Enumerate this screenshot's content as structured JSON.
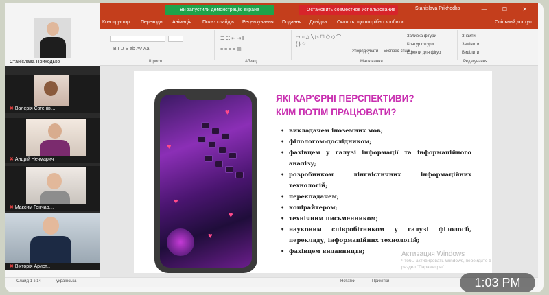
{
  "sharebar": {
    "green_notice": "Ви запустили демонстрацію екрана",
    "red_button": "Остановить совместное использование",
    "presenter": "Stanislava Prikhodko",
    "window_controls": "— ☐ ✕"
  },
  "ribbon": {
    "tabs": [
      "Конструктор",
      "Переходи",
      "Анімація",
      "Показ слайдів",
      "Рецензування",
      "Подання",
      "Довідка",
      "Скажіть, що потрібно зробити"
    ],
    "share_label": "Спільний доступ",
    "groups": [
      "Шрифт",
      "Абзац",
      "Малювання",
      "Редагування"
    ],
    "find": "Знайти",
    "replace": "Замінити",
    "select": "Виділити",
    "arrange": "Упорядкувати",
    "styles": "Експрес-стилі",
    "fill": "Заливка фігури",
    "outline": "Контур фігури",
    "effects": "Ефекти для фігур"
  },
  "participants": [
    {
      "name": "Станіслава Приходько"
    },
    {
      "name": "Валерія Євгенів…"
    },
    {
      "name": "Андрій Нечмарич"
    },
    {
      "name": "Максим Гончар…"
    },
    {
      "name": "Вікторія Арист…"
    }
  ],
  "slide": {
    "title_line1": "ЯКІ КАР'ЄРНІ ПЕРСПЕКТИВИ?",
    "title_line2": "КИМ ПОТІМ ПРАЦЮВАТИ?",
    "bullets": [
      "викладачем іноземних мов;",
      "філологом-дослідником;",
      "фахівцем у галузі інформації та інформаційного аналізу;",
      "розробником лінгвістичних інформаційних технологій;",
      "перекладачем;",
      "копірайтером;",
      "технічним письменником;",
      "науковим співробітником у галузі філології, перекладу, інформаційних технологій;",
      "фахівцем видавництв;"
    ]
  },
  "status": {
    "slide_counter": "Слайд 1 з 14",
    "language": "українська",
    "notes": "Нотатки",
    "comments": "Примітки"
  },
  "watermark": {
    "line1": "Активация Windows",
    "line2": "Чтобы активировать Windows, перейдите в",
    "line3": "раздел \"Параметры\"."
  },
  "clock": "1:03 PM",
  "colors": {
    "accent_orange": "#c43e1c",
    "title_magenta": "#c92fb0",
    "notice_green": "#1ea34a",
    "stop_red": "#d7242a"
  }
}
